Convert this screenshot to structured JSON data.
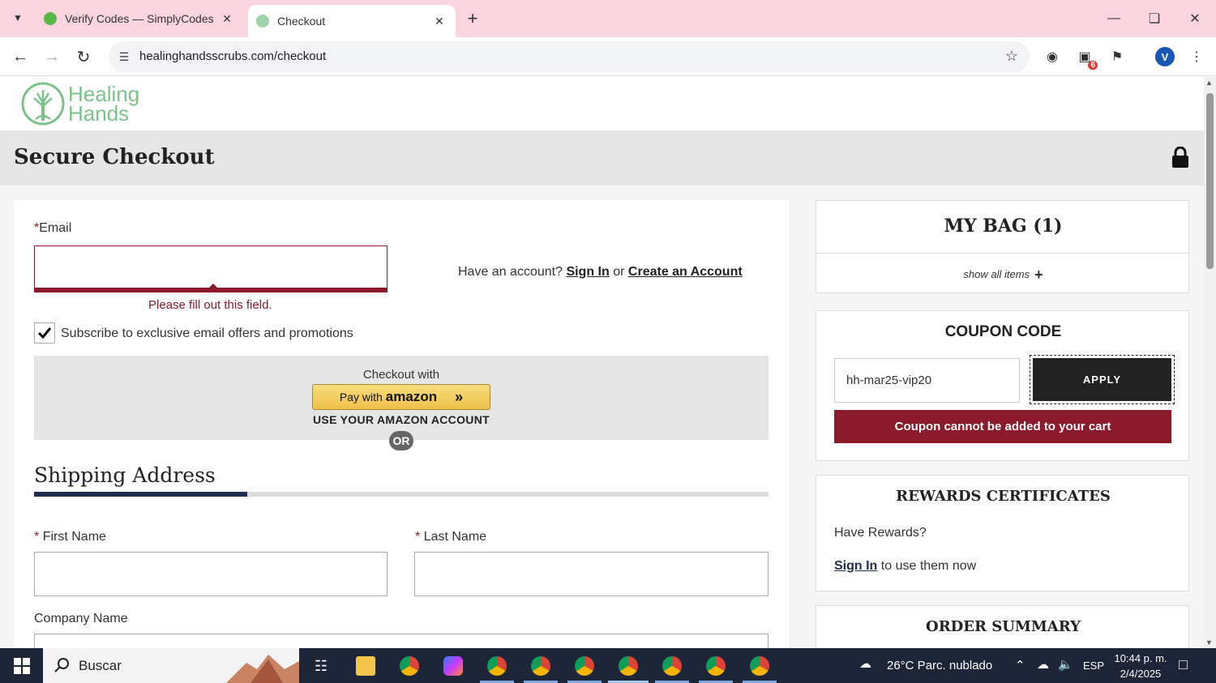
{
  "browser": {
    "tabs": [
      {
        "title": "Verify Codes — SimplyCodes",
        "active": false
      },
      {
        "title": "Checkout",
        "active": true
      }
    ],
    "url": "healinghandsscrubs.com/checkout",
    "profile_initial": "V",
    "extension_badge": "6"
  },
  "site": {
    "logo_line1": "Healing",
    "logo_line2": "Hands",
    "page_title": "Secure Checkout"
  },
  "checkout": {
    "email_label": "Email",
    "email_required_mark": "*",
    "email_value": "",
    "email_error": "Please fill out this field.",
    "account_prompt": "Have an account?",
    "sign_in_label": "Sign In",
    "or_text": "or",
    "create_account_label": "Create an Account",
    "subscribe_label": "Subscribe to exclusive email offers and promotions",
    "subscribe_checked": true,
    "checkout_with": "Checkout with",
    "amazon_pay_prefix": "Pay with",
    "amazon_brand": "amazon",
    "use_amazon": "USE YOUR AMAZON ACCOUNT",
    "or_badge": "OR",
    "shipping_title": "Shipping Address",
    "shipping_progress": 0.29,
    "first_name_label": "First Name",
    "last_name_label": "Last Name",
    "required_mark": "*",
    "company_label": "Company Name"
  },
  "bag": {
    "title": "MY BAG (1)",
    "show_items": "show all items"
  },
  "coupon": {
    "title": "COUPON CODE",
    "code_value": "hh-mar25-vip20",
    "apply_label": "APPLY",
    "error": "Coupon cannot be added to your cart"
  },
  "rewards": {
    "title": "REWARDS CERTIFICATES",
    "prompt": "Have Rewards?",
    "sign_in_label": "Sign In",
    "sign_in_suffix": "to use them now"
  },
  "summary": {
    "title": "ORDER SUMMARY"
  },
  "taskbar": {
    "search_placeholder": "Buscar",
    "weather": "26°C  Parc. nublado",
    "language": "ESP",
    "time": "10:44 p. m.",
    "date": "2/4/2025"
  },
  "colors": {
    "tabstrip": "#fbd5de",
    "brand_green": "#7cc28a",
    "error_red": "#8b1a2b",
    "navy": "#1f2e4d"
  }
}
